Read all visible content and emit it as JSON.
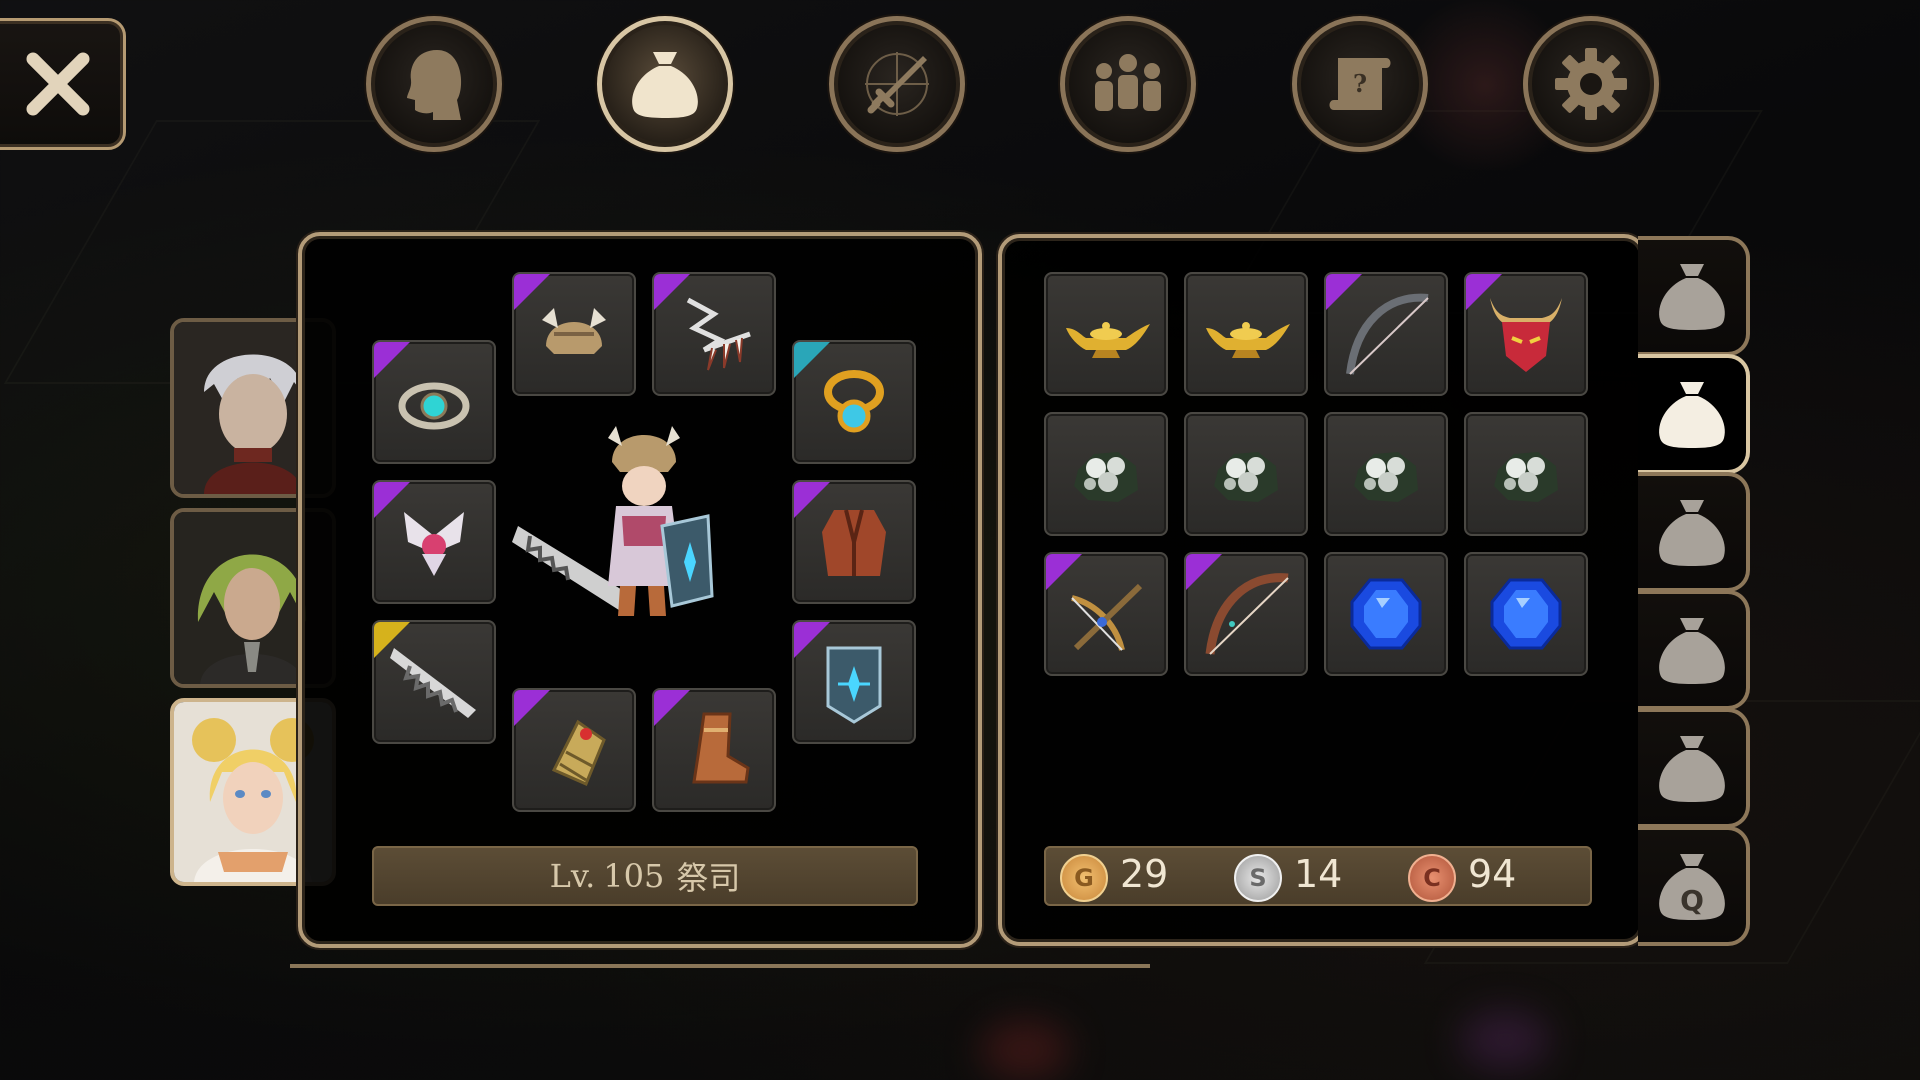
{
  "character": {
    "level_prefix": "Lv.",
    "level": "105",
    "class": "祭司"
  },
  "currency": {
    "gold": {
      "symbol": "G",
      "value": "29"
    },
    "silver": {
      "symbol": "S",
      "value": "14"
    },
    "copper": {
      "symbol": "C",
      "value": "94"
    }
  },
  "top_tabs": [
    "character-head-icon",
    "inventory-bag-icon",
    "combat-sword-icon",
    "party-members-icon",
    "quest-scroll-icon",
    "settings-gear-icon"
  ],
  "active_top_tab": 1,
  "side_tabs": [
    {
      "icon": "bag-icon",
      "active": false
    },
    {
      "icon": "bag-icon",
      "active": true
    },
    {
      "icon": "bag-icon",
      "active": false
    },
    {
      "icon": "bag-icon",
      "active": false
    },
    {
      "icon": "bag-icon",
      "active": false
    },
    {
      "icon": "quest-bag-icon",
      "label": "Q",
      "active": false
    }
  ],
  "colors": {
    "rarity_epic": "#9b2fd6",
    "rarity_rare": "#2aa6b8",
    "rarity_legendary": "#d6b21c",
    "panel_border": "#b39b78",
    "gold_coin": "#d9a04a",
    "silver_coin": "#b8b8b8",
    "copper_coin": "#c0674a"
  }
}
